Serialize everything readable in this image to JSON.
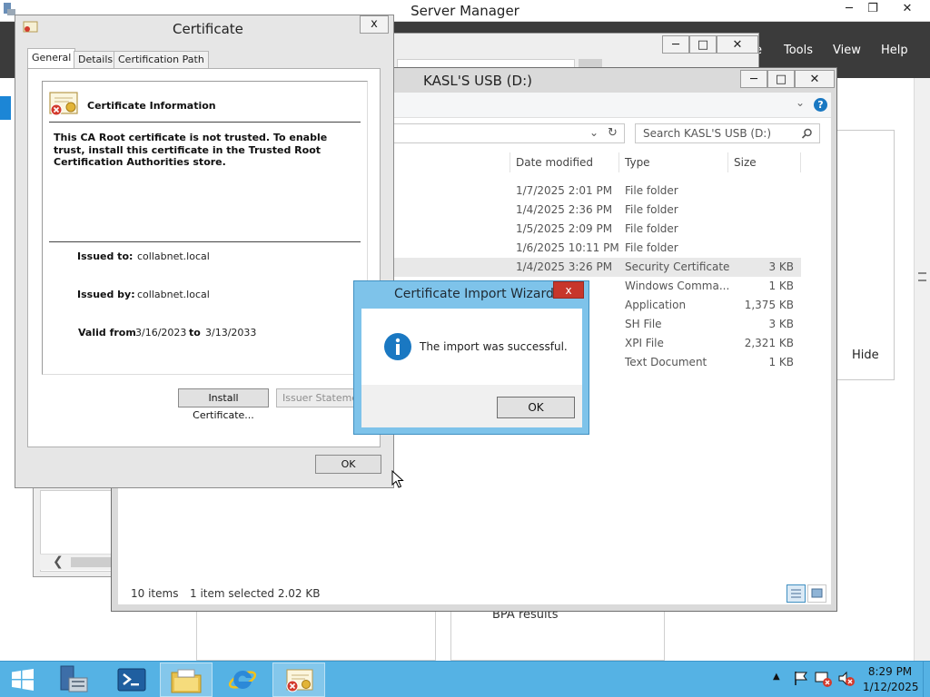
{
  "server_manager": {
    "title": "Server Manager",
    "menu": [
      "Tools",
      "View",
      "Help"
    ],
    "menu_partial": "e",
    "hide_label": "Hide",
    "bpa_label": "BPA results"
  },
  "explorer": {
    "title": "KASL'S USB (D:)",
    "search_placeholder": "Search KASL'S USB (D:)",
    "columns": [
      "Date modified",
      "Type",
      "Size"
    ],
    "rows": [
      {
        "date": "1/7/2025 2:01 PM",
        "type": "File folder",
        "size": ""
      },
      {
        "date": "1/4/2025 2:36 PM",
        "type": "File folder",
        "size": ""
      },
      {
        "date": "1/5/2025 2:09 PM",
        "type": "File folder",
        "size": ""
      },
      {
        "date": "1/6/2025 10:11 PM",
        "type": "File folder",
        "size": ""
      },
      {
        "date": "1/4/2025 3:26 PM",
        "type": "Security Certificate",
        "size": "3 KB"
      },
      {
        "date": "",
        "type": "Windows Comma...",
        "size": "1 KB"
      },
      {
        "date": "",
        "type": "Application",
        "size": "1,375 KB"
      },
      {
        "date": "",
        "type": "SH File",
        "size": "3 KB"
      },
      {
        "date": "",
        "type": "XPI File",
        "size": "2,321 KB"
      },
      {
        "date": "",
        "type": "Text Document",
        "size": "1 KB"
      }
    ],
    "status_items": "10 items",
    "status_selected": "1 item selected  2.02 KB"
  },
  "certificate": {
    "title": "Certificate",
    "close": "x",
    "tabs": [
      "General",
      "Details",
      "Certification Path"
    ],
    "info_title": "Certificate Information",
    "message": "This CA Root certificate is not trusted. To enable trust, install this certificate in the Trusted Root Certification Authorities store.",
    "issued_to_label": "Issued to:",
    "issued_to": "collabnet.local",
    "issued_by_label": "Issued by:",
    "issued_by": "collabnet.local",
    "valid_from_label": "Valid from",
    "valid_from": "3/16/2023",
    "valid_to_label": "to",
    "valid_to": "3/13/2033",
    "install_button": "Install Certificate...",
    "issuer_button": "Issuer Statement",
    "ok_button": "OK"
  },
  "wizard": {
    "title": "Certificate Import Wizard",
    "message": "The import was successful.",
    "ok_button": "OK",
    "close": "x"
  },
  "taskbar": {
    "time": "8:29 PM",
    "date": "1/12/2025"
  },
  "colors": {
    "taskbar": "#55b2e4",
    "wizard_frame": "#7ec3ea",
    "close_red": "#c7362b",
    "info_blue": "#1a78c2"
  }
}
